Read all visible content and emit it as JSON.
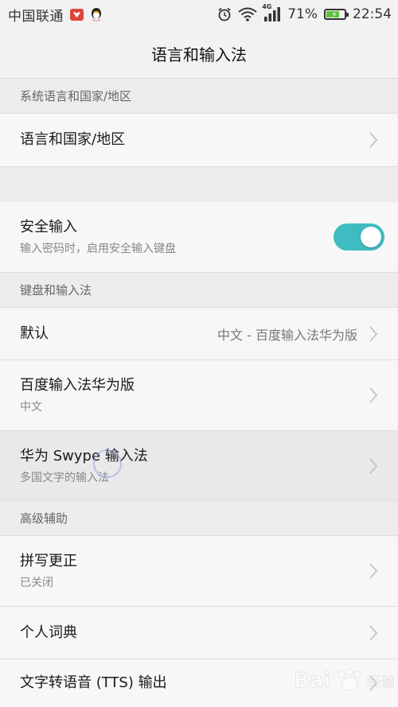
{
  "status_bar": {
    "carrier": "中国联通",
    "battery_percent": "71%",
    "battery_level": 0.71,
    "network": "4G",
    "time": "22:54"
  },
  "title": "语言和输入法",
  "sections": {
    "system_language_header": "系统语言和国家/地区",
    "keyboard_header": "键盘和输入法",
    "advanced_header": "高级辅助"
  },
  "rows": {
    "language_region": {
      "title": "语言和国家/地区"
    },
    "secure_input": {
      "title": "安全输入",
      "subtitle": "输入密码时，启用安全输入键盘",
      "enabled": true
    },
    "default_ime": {
      "title": "默认",
      "value": "中文 - 百度输入法华为版"
    },
    "baidu_ime": {
      "title": "百度输入法华为版",
      "subtitle": "中文"
    },
    "swype_ime": {
      "title": "华为 Swype 输入法",
      "subtitle": "多国文字的输入法"
    },
    "spell_check": {
      "title": "拼写更正",
      "subtitle": "已关闭"
    },
    "personal_dict": {
      "title": "个人词典"
    },
    "tts_output": {
      "title": "文字转语音 (TTS) 输出"
    }
  },
  "colors": {
    "toggle_on": "#3ebcc1",
    "battery_fill": "#5fc23e",
    "app_badge": "#e0443a"
  }
}
